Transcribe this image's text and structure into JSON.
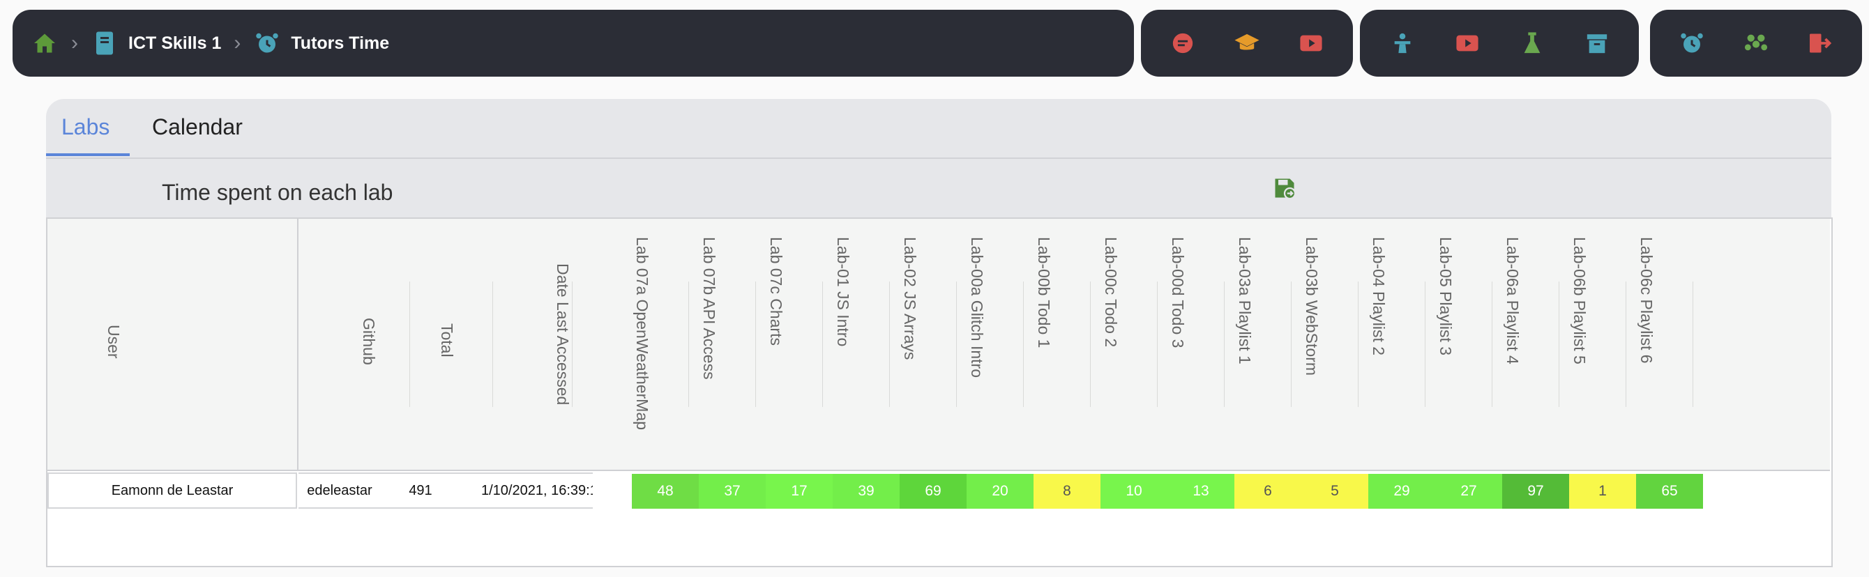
{
  "breadcrumb": {
    "items": [
      {
        "label": "ICT Skills 1",
        "icon": "notebook-icon"
      },
      {
        "label": "Tutors Time",
        "icon": "alarm-clock-icon"
      }
    ],
    "home_icon": "home-icon"
  },
  "toolbar_groups": [
    [
      "chat-icon",
      "graduation-cap-icon",
      "youtube-icon"
    ],
    [
      "presenter-icon",
      "youtube-icon",
      "flask-icon",
      "archive-icon"
    ],
    [
      "alarm-clock-icon",
      "users-icon",
      "logout-icon"
    ]
  ],
  "colors": {
    "nav_bg": "#2b2d36",
    "accent": "#5b85d9",
    "home": "#5d9a3a",
    "teal": "#4aa3b8",
    "red": "#d9534f",
    "orange": "#e69b2a",
    "green": "#6aa84f"
  },
  "tabs": [
    {
      "label": "Labs",
      "active": true
    },
    {
      "label": "Calendar",
      "active": false
    }
  ],
  "panel_title": "Time spent on each lab",
  "table": {
    "headers": {
      "user": "User",
      "github": "Github",
      "total": "Total",
      "date": "Date Last Accessed"
    },
    "labs": [
      "Lab 07a OpenWeatherMap",
      "Lab 07b API Access",
      "Lab 07c Charts",
      "Lab-01 JS Intro",
      "Lab-02 JS Arrays",
      "Lab-00a Glitch Intro",
      "Lab-00b Todo 1",
      "Lab-00c Todo 2",
      "Lab-00d Todo 3",
      "Lab-03a Playlist 1",
      "Lab-03b WebStorm",
      "Lab-04 Playlist 2",
      "Lab-05 Playlist 3",
      "Lab-06a Playlist 4",
      "Lab-06b Playlist 5",
      "Lab-06c Playlist 6"
    ],
    "rows": [
      {
        "user": "Eamonn de Leastar",
        "github": "edeleastar",
        "total": "491",
        "date": "1/10/2021, 16:39:1",
        "values": [
          "48",
          "37",
          "17",
          "39",
          "69",
          "20",
          "8",
          "10",
          "13",
          "6",
          "5",
          "29",
          "27",
          "97",
          "1",
          "65"
        ],
        "colors": [
          "#6fdd45",
          "#73ee4a",
          "#78f54c",
          "#73ee4a",
          "#5ed63b",
          "#73ee4a",
          "#f8f84a",
          "#78f54c",
          "#78f54c",
          "#f8f84a",
          "#f8f84a",
          "#73ee4a",
          "#73ee4a",
          "#54bb37",
          "#f8f84a",
          "#62d43f"
        ],
        "text_dark": [
          false,
          false,
          false,
          false,
          false,
          false,
          true,
          false,
          false,
          true,
          true,
          false,
          false,
          false,
          true,
          false
        ]
      }
    ]
  }
}
